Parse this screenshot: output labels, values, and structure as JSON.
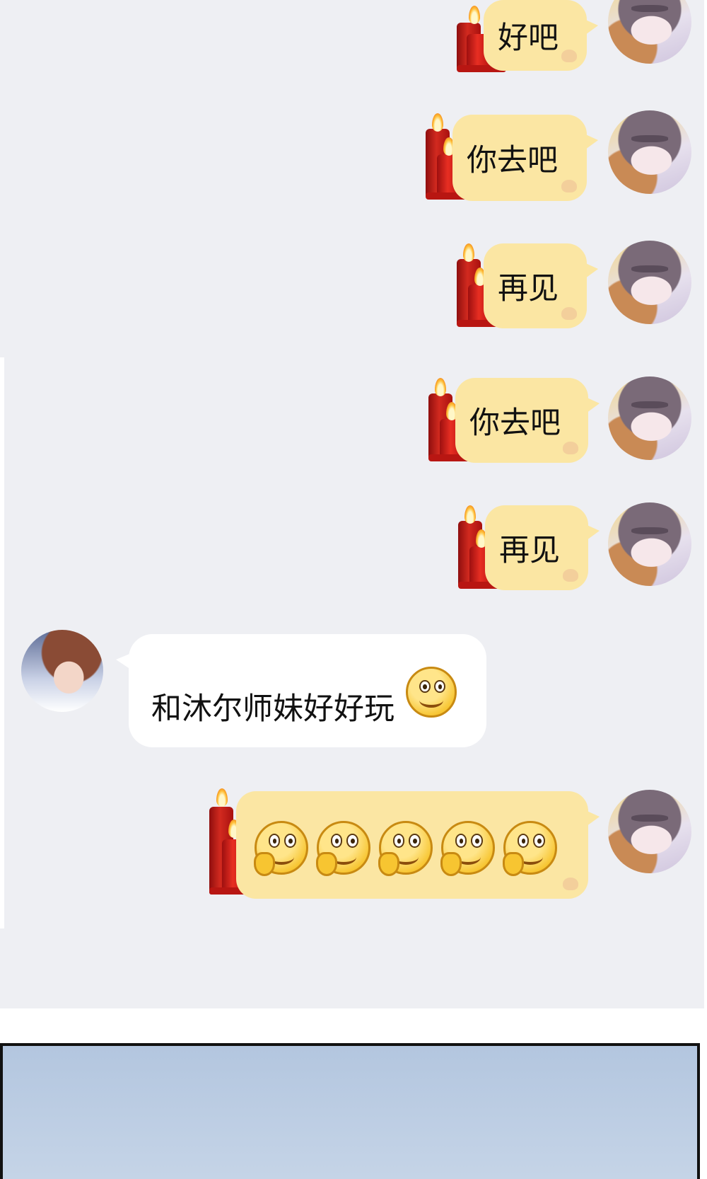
{
  "chat": {
    "messages": [
      {
        "side": "right",
        "text": "好吧"
      },
      {
        "side": "right",
        "text": "你去吧"
      },
      {
        "side": "right",
        "text": "再见"
      },
      {
        "side": "right",
        "text": "你去吧"
      },
      {
        "side": "right",
        "text": "再见"
      },
      {
        "side": "left",
        "text": "和沐尔师妹好好玩",
        "emoji": "smile-emoji"
      },
      {
        "side": "right",
        "emoji": "hand-smile-emoji",
        "emoji_count": 5
      }
    ]
  },
  "colors": {
    "chat_background": "#eeeff3",
    "my_bubble": "#fbe6a3",
    "their_bubble": "#ffffff",
    "candle": "#c41e18",
    "panel_sky": "#b3c6df"
  }
}
